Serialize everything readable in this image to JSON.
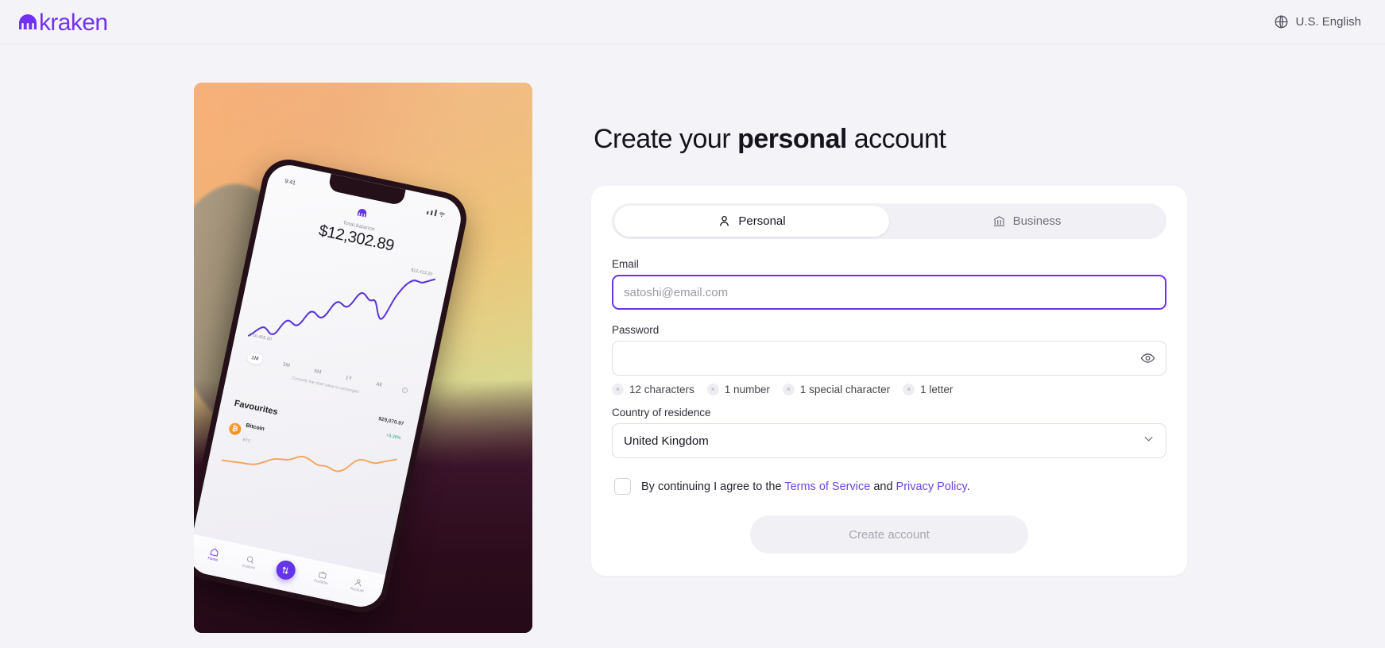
{
  "header": {
    "brand": "kraken",
    "brand_color": "#7132f5",
    "language": "U.S. English",
    "globe_icon": "globe-icon"
  },
  "page": {
    "title_prefix": "Create your ",
    "title_emphasis": "personal",
    "title_suffix": " account"
  },
  "account_type": {
    "options": [
      {
        "label": "Personal",
        "icon": "person-icon",
        "active": true
      },
      {
        "label": "Business",
        "icon": "bank-icon",
        "active": false
      }
    ]
  },
  "form": {
    "email": {
      "label": "Email",
      "placeholder": "satoshi@email.com",
      "value": "",
      "focused": true
    },
    "password": {
      "label": "Password",
      "placeholder": "",
      "value": "",
      "toggle_icon": "eye-icon",
      "requirements": [
        {
          "text": "12 characters",
          "met": false,
          "badge": "×"
        },
        {
          "text": "1 number",
          "met": false,
          "badge": "×"
        },
        {
          "text": "1 special character",
          "met": false,
          "badge": "×"
        },
        {
          "text": "1 letter",
          "met": false,
          "badge": "×"
        }
      ]
    },
    "country": {
      "label": "Country of residence",
      "value": "United Kingdom",
      "chevron_icon": "chevron-down-icon"
    },
    "terms": {
      "checked": false,
      "prefix": "By continuing I agree to the ",
      "link_terms": "Terms of Service",
      "middle": " and ",
      "link_privacy": "Privacy Policy",
      "suffix": "."
    },
    "submit": {
      "label": "Create account",
      "disabled": true
    }
  },
  "promo_image": {
    "alt": "Hand holding a phone showing the Kraken app",
    "phone_app": {
      "balance_label": "Total balance",
      "balance_value": "$12,302.89",
      "chart_high": "$12,413.20",
      "chart_low": "$ 10,402.20",
      "ranges": [
        "1M",
        "3M",
        "6M",
        "1Y",
        "All"
      ],
      "active_range": "1M",
      "chart_note": "Currently the chart value is unchanged",
      "favourites_title": "Favourites",
      "favourite_price": "$29,070.97",
      "favourite_change": "+3.26%",
      "coin_name": "Bitcoin",
      "coin_symbol": "BTC",
      "coin_badge": "₿",
      "status_time": "9:41",
      "tabs": [
        "Home",
        "Explore",
        "Portfolio",
        "Account"
      ],
      "active_tab": "Home",
      "accent_color": "#6434e8",
      "coin_color": "#f0932b"
    }
  }
}
